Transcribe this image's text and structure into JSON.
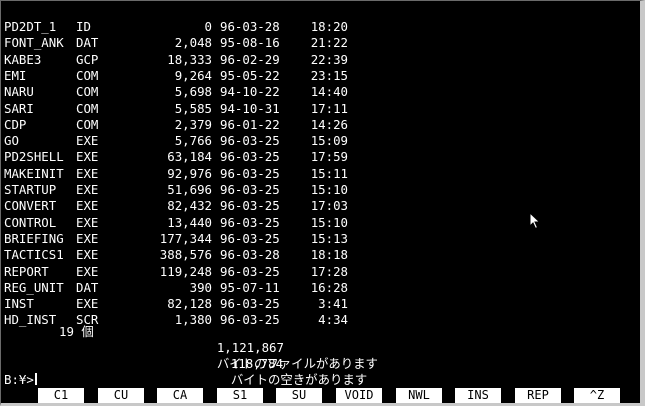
{
  "files": [
    {
      "name": "PD2DT_1",
      "ext": "ID",
      "size": "0",
      "date": "96-03-28",
      "time": "18:20"
    },
    {
      "name": "FONT_ANK",
      "ext": "DAT",
      "size": "2,048",
      "date": "95-08-16",
      "time": "21:22"
    },
    {
      "name": "KABE3",
      "ext": "GCP",
      "size": "18,333",
      "date": "96-02-29",
      "time": "22:39"
    },
    {
      "name": "EMI",
      "ext": "COM",
      "size": "9,264",
      "date": "95-05-22",
      "time": "23:15"
    },
    {
      "name": "NARU",
      "ext": "COM",
      "size": "5,698",
      "date": "94-10-22",
      "time": "14:40"
    },
    {
      "name": "SARI",
      "ext": "COM",
      "size": "5,585",
      "date": "94-10-31",
      "time": "17:11"
    },
    {
      "name": "CDP",
      "ext": "COM",
      "size": "2,379",
      "date": "96-01-22",
      "time": "14:26"
    },
    {
      "name": "GO",
      "ext": "EXE",
      "size": "5,766",
      "date": "96-03-25",
      "time": "15:09"
    },
    {
      "name": "PD2SHELL",
      "ext": "EXE",
      "size": "63,184",
      "date": "96-03-25",
      "time": "17:59"
    },
    {
      "name": "MAKEINIT",
      "ext": "EXE",
      "size": "92,976",
      "date": "96-03-25",
      "time": "15:11"
    },
    {
      "name": "STARTUP",
      "ext": "EXE",
      "size": "51,696",
      "date": "96-03-25",
      "time": "15:10"
    },
    {
      "name": "CONVERT",
      "ext": "EXE",
      "size": "82,432",
      "date": "96-03-25",
      "time": "17:03"
    },
    {
      "name": "CONTROL",
      "ext": "EXE",
      "size": "13,440",
      "date": "96-03-25",
      "time": "15:10"
    },
    {
      "name": "BRIEFING",
      "ext": "EXE",
      "size": "177,344",
      "date": "96-03-25",
      "time": "15:13"
    },
    {
      "name": "TACTICS1",
      "ext": "EXE",
      "size": "388,576",
      "date": "96-03-28",
      "time": "18:18"
    },
    {
      "name": "REPORT",
      "ext": "EXE",
      "size": "119,248",
      "date": "96-03-25",
      "time": "17:28"
    },
    {
      "name": "REG_UNIT",
      "ext": "DAT",
      "size": "390",
      "date": "95-07-11",
      "time": "16:28"
    },
    {
      "name": "INST",
      "ext": "EXE",
      "size": "82,128",
      "date": "96-03-25",
      "time": "3:41"
    },
    {
      "name": "HD_INST",
      "ext": "SCR",
      "size": "1,380",
      "date": "96-03-25",
      "time": "4:34"
    }
  ],
  "summary": {
    "file_count": "19 個",
    "total_bytes": "1,121,867",
    "total_text": "バイトのファイルがあります",
    "free_bytes": "118,784",
    "free_text": "バイトの空きがあります"
  },
  "prompt": "B:¥>",
  "function_keys": [
    "C1",
    "CU",
    "CA",
    "S1",
    "SU",
    "VOID",
    "NWL",
    "INS",
    "REP",
    "^Z"
  ],
  "colors": {
    "background": "#000000",
    "text": "#ffffff",
    "function_key_bg": "#ffffff",
    "function_key_text": "#000000"
  }
}
